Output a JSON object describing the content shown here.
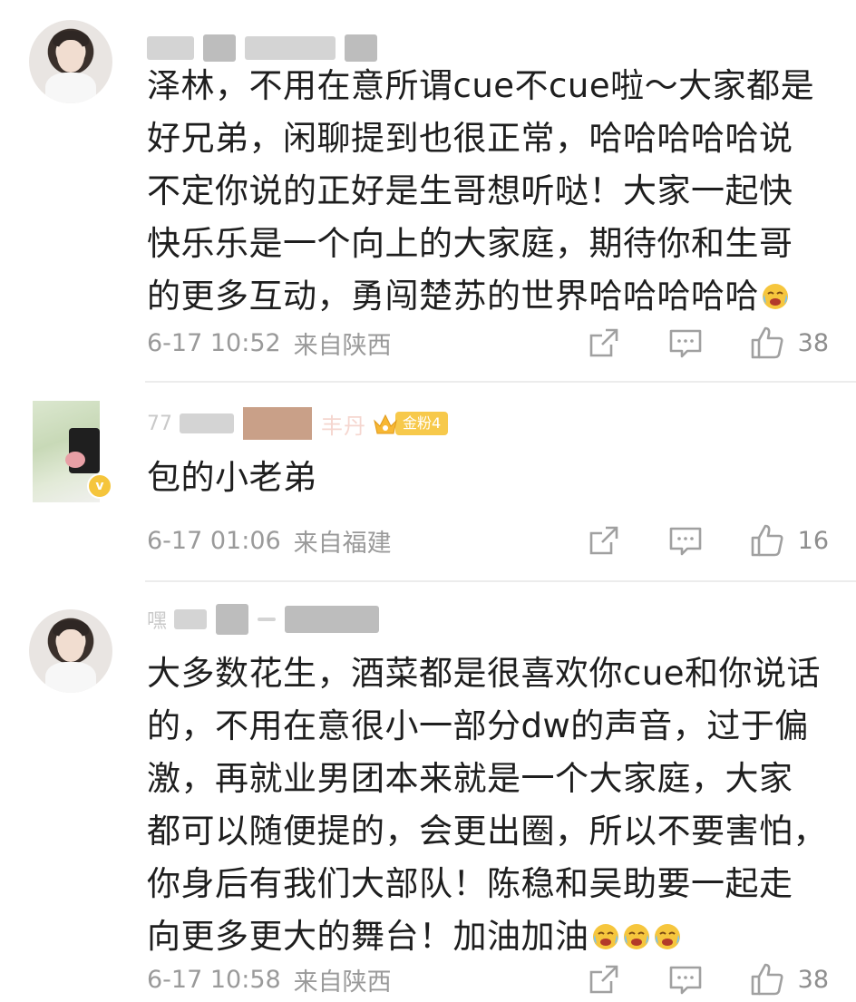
{
  "comments": [
    {
      "content_lines": [
        "泽林，不用在意所谓cue不cue啦～大家都是",
        "好兄弟，闲聊提到也很正常，哈哈哈哈哈说",
        "不定你说的正好是生哥想听哒！大家一起快",
        "快乐乐是一个向上的大家庭，期待你和生哥",
        "的更多互动，勇闯楚苏的世界哈哈哈哈哈"
      ],
      "time": "6-17 10:52",
      "location": "来自陕西",
      "likes": "38",
      "emoji_count": 1
    },
    {
      "username_partial": "丰丹",
      "fan_badge": "金粉4",
      "content_lines": [
        "包的小老弟"
      ],
      "time": "6-17 01:06",
      "location": "来自福建",
      "likes": "16"
    },
    {
      "content_lines": [
        "大多数花生，酒菜都是很喜欢你cue和你说话",
        "的，不用在意很小一部分dw的声音，过于偏",
        "激，再就业男团本来就是一个大家庭，大家",
        "都可以随便提的，会更出圈，所以不要害怕，",
        "你身后有我们大部队！陈稳和吴助要一起走",
        "向更多更大的舞台！加油加油"
      ],
      "time": "6-17 10:58",
      "location": "来自陕西",
      "likes": "38",
      "emoji_count": 3
    }
  ],
  "colors": {
    "text": "#1e1e1e",
    "meta": "#9a9a9a",
    "fan_badge": "#f7c94b",
    "divider": "#ececec"
  }
}
